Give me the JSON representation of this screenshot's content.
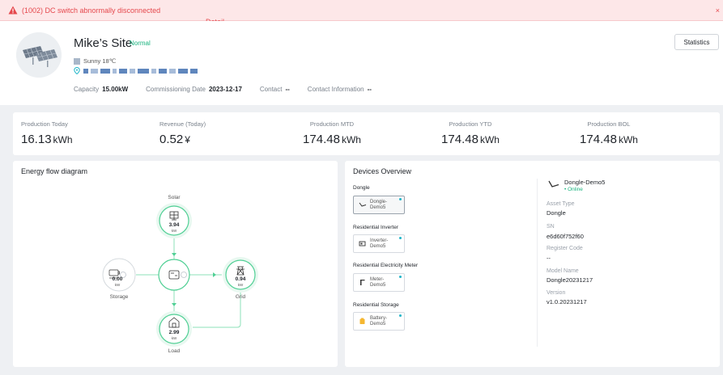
{
  "alert": {
    "message": "(1002) DC switch abnormally disconnected",
    "link": "Detail",
    "close": "×"
  },
  "site": {
    "name": "Mike’s Site",
    "status": "Normal",
    "weather": "Sunny 18℃",
    "capacity_label": "Capacity",
    "capacity_value": "15.00kW",
    "commissioning_label": "Commissioning Date",
    "commissioning_value": "2023-12-17",
    "contact_label": "Contact",
    "contact_value": "--",
    "contact_info_label": "Contact Information",
    "contact_info_value": "--",
    "statistics_button": "Statistics"
  },
  "kpis": [
    {
      "label": "Production Today",
      "value": "16.13",
      "unit": "kWh"
    },
    {
      "label": "Revenue (Today)",
      "value": "0.52",
      "unit": "¥"
    },
    {
      "label": "Production MTD",
      "value": "174.48",
      "unit": "kWh"
    },
    {
      "label": "Production YTD",
      "value": "174.48",
      "unit": "kWh"
    },
    {
      "label": "Production BOL",
      "value": "174.48",
      "unit": "kWh"
    }
  ],
  "energy_flow": {
    "title": "Energy flow diagram",
    "solar": {
      "label": "Solar",
      "value": "3.94",
      "unit": "kW"
    },
    "storage": {
      "label": "Storage",
      "value": "0.00",
      "unit": "kW"
    },
    "grid": {
      "label": "Grid",
      "value": "0.94",
      "unit": "kW"
    },
    "load": {
      "label": "Load",
      "value": "2.99",
      "unit": "kW"
    }
  },
  "devices": {
    "title": "Devices Overview",
    "groups": [
      {
        "label": "Dongle",
        "device": "Dongle-Demo5"
      },
      {
        "label": "Residential Inverter",
        "device": "Inverter-Demo5"
      },
      {
        "label": "Residential Electricity Meter",
        "device": "Meter-Demo5"
      },
      {
        "label": "Residential Storage",
        "device": "Battery-Demo5"
      }
    ],
    "selected": {
      "name": "Dongle-Demo5",
      "status": "• Online",
      "fields": [
        {
          "key": "Asset Type",
          "value": "Dongle"
        },
        {
          "key": "SN",
          "value": "e6d60f752f60"
        },
        {
          "key": "Register Code",
          "value": "--"
        },
        {
          "key": "Model Name",
          "value": "Dongle20231217"
        },
        {
          "key": "Version",
          "value": "v1.0.20231217"
        }
      ]
    }
  },
  "colors": {
    "accent_green": "#18b37e",
    "alert_red": "#e5484d",
    "flow_green": "#7fdcb0"
  }
}
